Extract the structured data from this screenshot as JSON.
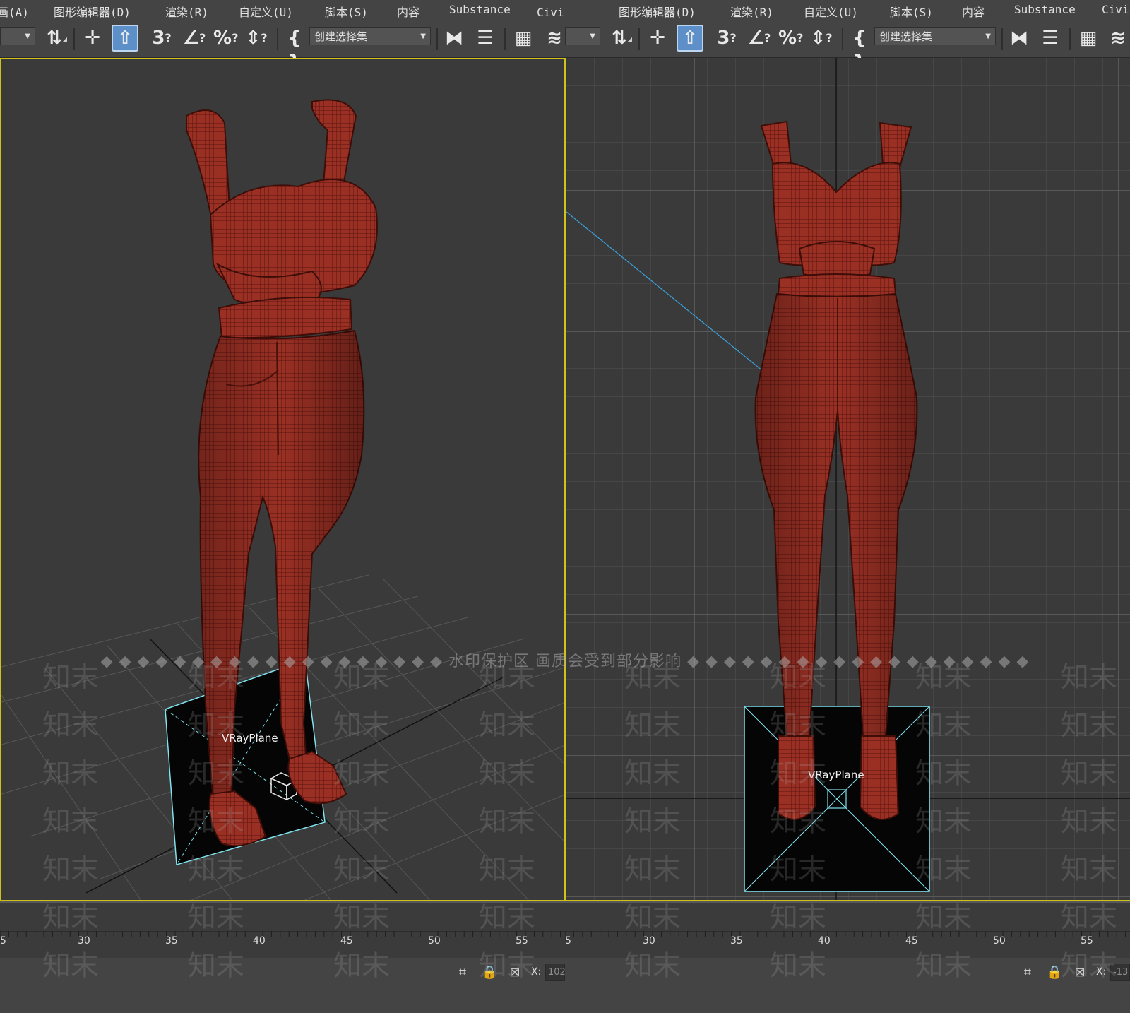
{
  "menu": {
    "left": [
      "画(A)",
      "图形编辑器(D)",
      "渲染(R)",
      "自定义(U)",
      "脚本(S)",
      "内容",
      "Substance",
      "Civil画(A)"
    ],
    "right": [
      "图形编辑器(D)",
      "渲染(R)",
      "自定义(U)",
      "脚本(S)",
      "内容",
      "Substance",
      "Civi"
    ]
  },
  "toolbar": {
    "selection_set_placeholder": "创建选择集",
    "snap_3_label": "3",
    "angle_snap_label": "∠",
    "percent_snap_label": "%",
    "icons": [
      "select-and-link-icon",
      "move-icon",
      "select-object-icon",
      "snap-3d-icon",
      "angle-snap-icon",
      "percent-snap-icon",
      "spinner-snap-icon",
      "edit-named-selection-icon",
      "mirror-icon",
      "align-icon",
      "scene-explorer-icon",
      "layer-explorer-icon"
    ]
  },
  "viewport_left": {
    "object_label": "VRayPlane",
    "border_color": "#d1c21a"
  },
  "viewport_right": {
    "object_label": "VRayPlane"
  },
  "timeline_left": {
    "ticks": [
      "5",
      "30",
      "35",
      "40",
      "45",
      "50",
      "55"
    ]
  },
  "timeline_right": {
    "ticks": [
      "5",
      "30",
      "35",
      "40",
      "45",
      "50",
      "55"
    ]
  },
  "status_left": {
    "x_label": "X:",
    "x_value": "102"
  },
  "status_right": {
    "x_label": "X:",
    "x_value": "-13"
  },
  "watermark": {
    "strip_text": "◆ ◆ ◆ ◆ ◆ ◆ ◆ ◆ ◆ ◆ ◆ ◆ ◆ ◆ ◆ ◆ ◆ ◆ ◆ 水印保护区   画质会受到部分影响 ◆ ◆ ◆ ◆ ◆ ◆ ◆ ◆ ◆ ◆ ◆ ◆ ◆ ◆ ◆ ◆ ◆ ◆ ◆",
    "tile_text": "知末"
  },
  "colors": {
    "mesh_red": "#8e2a20",
    "mesh_dark": "#5a1510",
    "plane_cyan": "#7fe3ee",
    "viewport_bg": "#3a3a3a"
  }
}
